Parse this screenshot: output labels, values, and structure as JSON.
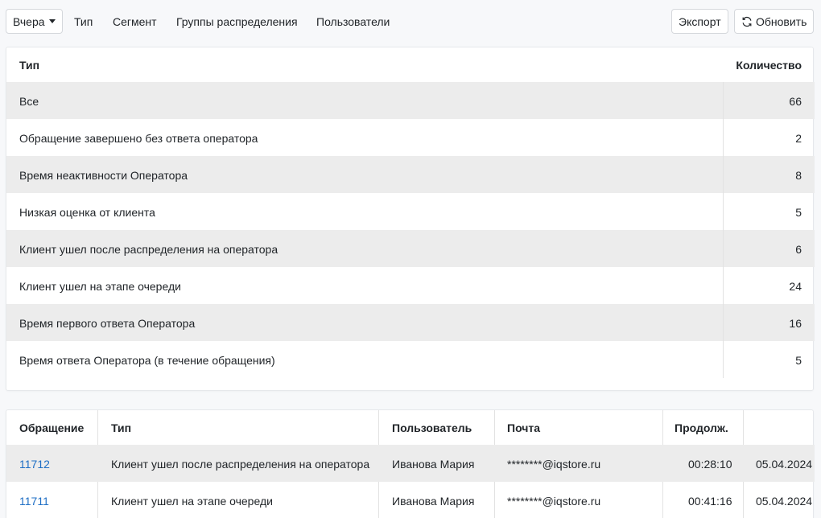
{
  "toolbar": {
    "period_label": "Вчера",
    "nav": [
      "Тип",
      "Сегмент",
      "Группы распределения",
      "Пользователи"
    ],
    "export_label": "Экспорт",
    "refresh_label": "Обновить"
  },
  "summary_table": {
    "headers": {
      "type": "Тип",
      "count": "Количество"
    },
    "rows": [
      {
        "type": "Все",
        "count": "66"
      },
      {
        "type": "Обращение завершено без ответа оператора",
        "count": "2"
      },
      {
        "type": "Время неактивности Оператора",
        "count": "8"
      },
      {
        "type": "Низкая оценка от клиента",
        "count": "5"
      },
      {
        "type": "Клиент ушел после распределения на оператора",
        "count": "6"
      },
      {
        "type": "Клиент ушел на этапе очереди",
        "count": "24"
      },
      {
        "type": "Время первого ответа Оператора",
        "count": "16"
      },
      {
        "type": "Время ответа Оператора (в течение обращения)",
        "count": "5"
      }
    ]
  },
  "detail_table": {
    "headers": {
      "ticket": "Обращение",
      "type": "Тип",
      "user": "Пользователь",
      "email": "Почта",
      "duration": "Продолж."
    },
    "rows": [
      {
        "ticket": "11712",
        "type": "Клиент ушел после распределения на оператора",
        "user": "Иванова Мария",
        "email": "********@iqstore.ru",
        "duration": "00:28:10",
        "date": "05.04.2024"
      },
      {
        "ticket": "11711",
        "type": "Клиент ушел на этапе очереди",
        "user": "Иванова Мария",
        "email": "********@iqstore.ru",
        "duration": "00:41:16",
        "date": "05.04.2024"
      }
    ]
  },
  "colors": {
    "link": "#1f6fc5",
    "row_shade": "#ececec",
    "background": "#f7f8fa"
  }
}
